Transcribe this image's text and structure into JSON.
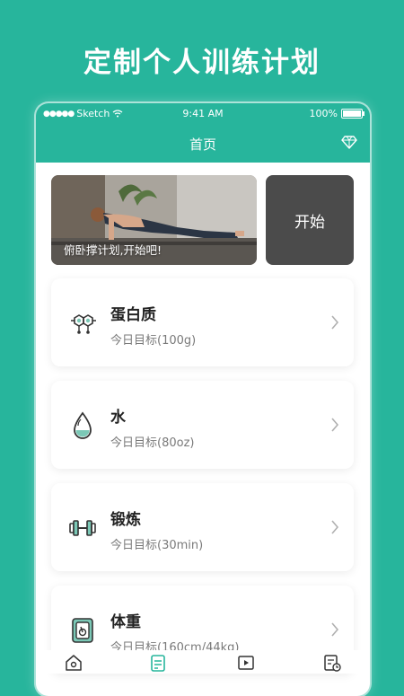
{
  "headline": "定制个人训练计划",
  "status_bar": {
    "carrier": "Sketch",
    "time": "9:41 AM",
    "battery": "100%"
  },
  "nav": {
    "title": "首页",
    "icon": "diamond-icon"
  },
  "banner": {
    "caption": "俯卧撑计划,开始吧!",
    "start_label": "开始"
  },
  "cards": [
    {
      "title": "蛋白质",
      "subtitle": "今日目标(100g)",
      "icon": "molecule-icon"
    },
    {
      "title": "水",
      "subtitle": "今日目标(80oz)",
      "icon": "water-drop-icon"
    },
    {
      "title": "锻炼",
      "subtitle": "今日目标(30min)",
      "icon": "dumbbell-icon"
    },
    {
      "title": "体重",
      "subtitle": "今日目标(160cm/44kg)",
      "icon": "scale-icon"
    }
  ],
  "tabbar": {
    "icons": [
      "home-icon",
      "checklist-icon",
      "video-icon",
      "history-icon"
    ],
    "active_index": 1
  },
  "colors": {
    "accent": "#27b59c",
    "start_button": "#4b4b4b"
  }
}
